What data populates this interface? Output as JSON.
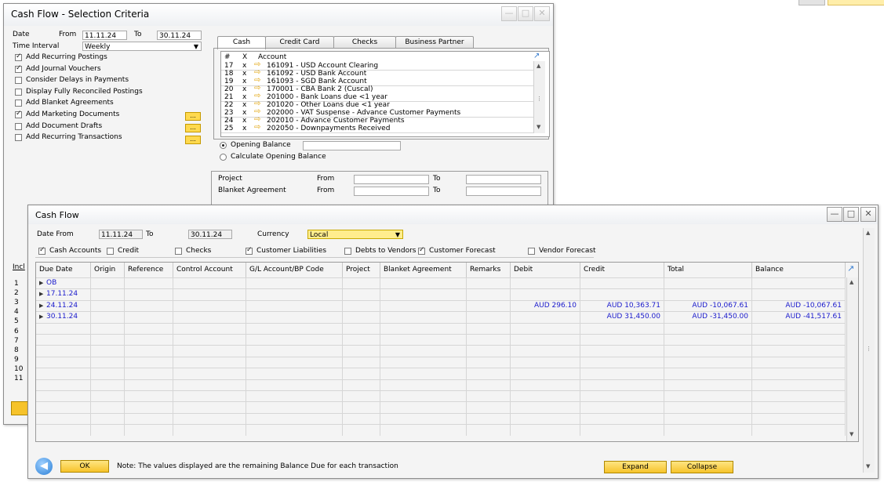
{
  "selection": {
    "title": "Cash Flow - Selection Criteria",
    "date_label": "Date",
    "from_label": "From",
    "from_value": "11.11.24",
    "to_label": "To",
    "to_value": "30.11.24",
    "interval_label": "Time Interval",
    "interval_value": "Weekly",
    "options": [
      {
        "label": "Add Recurring Postings",
        "checked": true
      },
      {
        "label": "Add Journal Vouchers",
        "checked": true
      },
      {
        "label": "Consider Delays in Payments",
        "checked": false
      },
      {
        "label": "Display Fully Reconciled Postings",
        "checked": false
      },
      {
        "label": "Add Blanket Agreements",
        "checked": false
      },
      {
        "label": "Add Marketing Documents",
        "checked": true
      },
      {
        "label": "Add Document Drafts",
        "checked": false
      },
      {
        "label": "Add Recurring Transactions",
        "checked": false
      }
    ],
    "dots_label": "...",
    "tabs": [
      "Cash",
      "Credit Card",
      "Checks",
      "Business Partner"
    ],
    "grid_headers": [
      "#",
      "X",
      "Account"
    ],
    "accounts": [
      {
        "num": "17",
        "x": "x",
        "account": "161091 - USD Account  Clearing"
      },
      {
        "num": "18",
        "x": "x",
        "account": "161092 - USD Bank Account"
      },
      {
        "num": "19",
        "x": "x",
        "account": "161093 - SGD Bank Account"
      },
      {
        "num": "20",
        "x": "x",
        "account": "170001 - CBA Bank 2 (Cuscal)"
      },
      {
        "num": "21",
        "x": "x",
        "account": "201000 - Bank Loans due <1 year"
      },
      {
        "num": "22",
        "x": "x",
        "account": "201020 - Other Loans due <1 year"
      },
      {
        "num": "23",
        "x": "x",
        "account": "202000 - VAT Suspense - Advance Customer Payments"
      },
      {
        "num": "24",
        "x": "x",
        "account": "202010 - Advance Customer Payments"
      },
      {
        "num": "25",
        "x": "x",
        "account": "202050 - Downpayments Received"
      }
    ],
    "opening_balance_label": "Opening Balance",
    "calc_opening_label": "Calculate Opening Balance",
    "project_label": "Project",
    "blanket_label": "Blanket Agreement",
    "from_text": "From",
    "to_text": "To",
    "peek_label": "Incl",
    "peek_rows": [
      "1",
      "2",
      "3",
      "4",
      "5",
      "6",
      "7",
      "8",
      "9",
      "10",
      "11"
    ]
  },
  "cashflow": {
    "title": "Cash Flow",
    "date_from_label": "Date From",
    "date_from_value": "11.11.24",
    "to_label": "To",
    "to_value": "30.11.24",
    "currency_label": "Currency",
    "currency_value": "Local",
    "filters": [
      {
        "label": "Cash Accounts",
        "checked": true
      },
      {
        "label": "Credit",
        "checked": false
      },
      {
        "label": "Checks",
        "checked": false
      },
      {
        "label": "Customer Liabilities",
        "checked": true
      },
      {
        "label": "Debts to Vendors",
        "checked": false
      },
      {
        "label": "Customer Forecast",
        "checked": true
      },
      {
        "label": "Vendor Forecast",
        "checked": false
      }
    ],
    "columns": [
      "Due Date",
      "Origin",
      "Reference",
      "Control Account",
      "G/L Account/BP Code",
      "Project",
      "Blanket Agreement",
      "Remarks",
      "Debit",
      "Credit",
      "Total",
      "Balance"
    ],
    "rows": [
      {
        "due": "OB",
        "debit": "",
        "credit": "",
        "total": "",
        "balance": ""
      },
      {
        "due": "17.11.24",
        "debit": "",
        "credit": "",
        "total": "",
        "balance": ""
      },
      {
        "due": "24.11.24",
        "debit": "AUD 296.10",
        "credit": "AUD 10,363.71",
        "total": "AUD -10,067.61",
        "balance": "AUD -10,067.61"
      },
      {
        "due": "30.11.24",
        "debit": "",
        "credit": "AUD 31,450.00",
        "total": "AUD -31,450.00",
        "balance": "AUD -41,517.61"
      }
    ],
    "ok_label": "OK",
    "note": "Note: The values displayed are the remaining Balance Due for each transaction",
    "expand_label": "Expand",
    "collapse_label": "Collapse"
  },
  "colors": {
    "accent_yellow": "#ffd94e",
    "link_blue": "#1a1acc"
  }
}
